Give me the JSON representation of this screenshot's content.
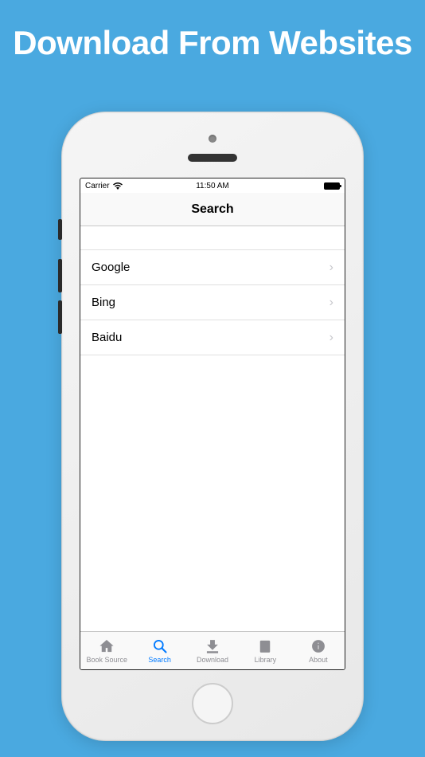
{
  "promo": {
    "title": "Download From Websites"
  },
  "status_bar": {
    "carrier": "Carrier",
    "time": "11:50 AM"
  },
  "nav": {
    "title": "Search"
  },
  "search_engines": [
    {
      "label": "Google"
    },
    {
      "label": "Bing"
    },
    {
      "label": "Baidu"
    }
  ],
  "tabs": [
    {
      "label": "Book Source",
      "active": false
    },
    {
      "label": "Search",
      "active": true
    },
    {
      "label": "Download",
      "active": false
    },
    {
      "label": "Library",
      "active": false
    },
    {
      "label": "About",
      "active": false
    }
  ]
}
